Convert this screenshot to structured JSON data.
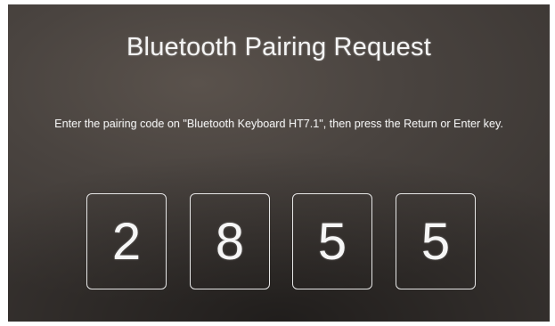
{
  "dialog": {
    "title": "Bluetooth Pairing Request",
    "instructions": "Enter the pairing code on \"Bluetooth Keyboard HT7.1\", then press the Return or Enter key.",
    "code_digits": [
      "2",
      "8",
      "5",
      "5"
    ]
  }
}
